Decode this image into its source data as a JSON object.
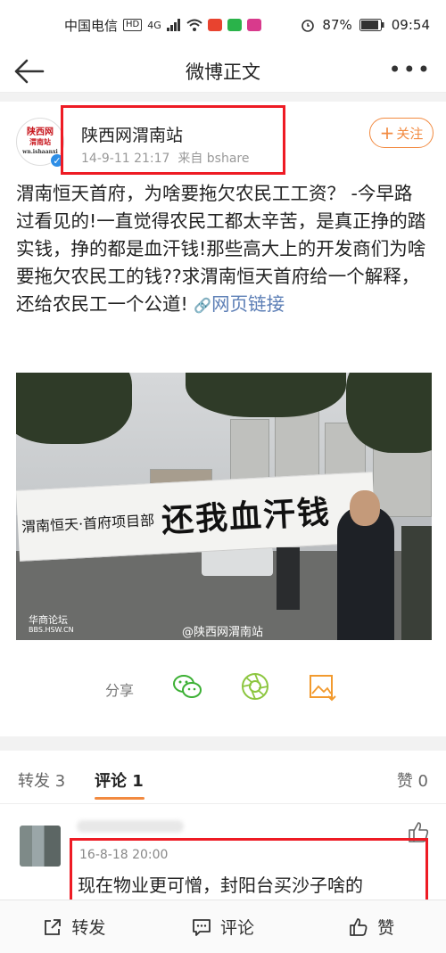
{
  "status_bar": {
    "carrier": "中国电信",
    "hd": "HD",
    "network": "4G",
    "battery": "87%",
    "time": "09:54"
  },
  "nav": {
    "title": "微博正文"
  },
  "post": {
    "author": "陕西网渭南站",
    "avatar_text": "陕西网",
    "avatar_subtext": "渭南站",
    "avatar_url_text": "wn.ishaanxi",
    "date": "14-9-11 21:17",
    "source": "来自 bshare",
    "follow_label": "关注",
    "text": "渭南恒天首府，为啥要拖欠农民工工资？ -今早路过看见的!一直觉得农民工都太辛苦，是真正挣的踏实钱，挣的都是血汗钱!那些高大上的开发商们为啥要拖欠农民工的钱??求渭南恒天首府给一个解释，还给农民工一个公道!",
    "link_label": "网页链接",
    "photo": {
      "banner_small": "渭南恒天·首府项目部",
      "banner_big": "还我血汗钱",
      "watermark_left_1": "华商论坛",
      "watermark_left_2": "BBS.HSW.CN",
      "watermark_right": "@陕西网渭南站"
    }
  },
  "share": {
    "label": "分享",
    "icons": [
      "wechat-icon",
      "moments-icon",
      "save-image-icon"
    ]
  },
  "tabs": {
    "repost": "转发 3",
    "comment": "评论 1",
    "like": "赞 0"
  },
  "comment": {
    "time": "16-8-18 20:00",
    "text": "现在物业更可憎，封阳台买沙子啥的"
  },
  "bottom_bar": {
    "repost": "转发",
    "comment": "评论",
    "like": "赞"
  },
  "colors": {
    "accent": "#f28a40",
    "highlight_box": "#ee1b24",
    "link": "#5d7fb6",
    "verified": "#2e8ee6"
  }
}
